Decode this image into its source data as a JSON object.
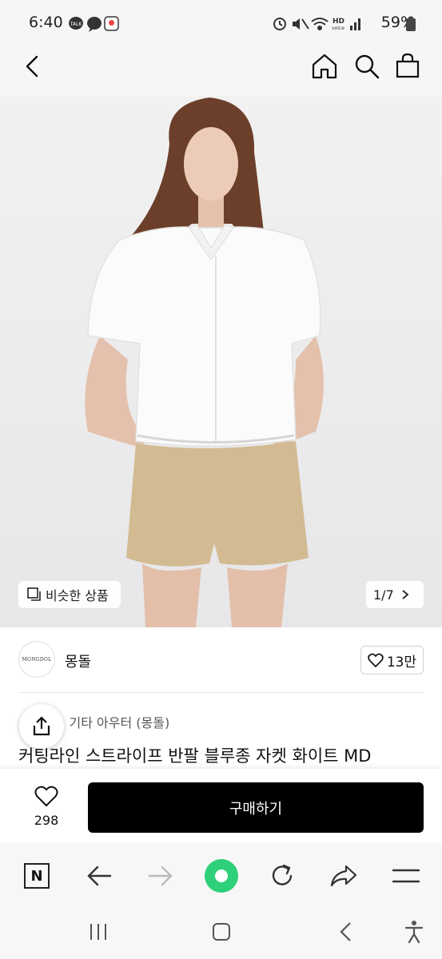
{
  "status_bar": {
    "time": "6:40",
    "battery": "59%",
    "icons": [
      "talk-icon",
      "chat-bubble-icon",
      "location-app-icon",
      "alarm-icon",
      "mute-icon",
      "wifi-icon",
      "hd-voice-icon",
      "signal-icon",
      "battery-icon"
    ]
  },
  "header": {
    "icons": [
      "back-arrow-icon",
      "home-icon",
      "search-icon",
      "shopping-bag-icon"
    ]
  },
  "hero": {
    "similar_label": "비슷한 상품",
    "counter": "1/7"
  },
  "shop": {
    "logo_text": "MONGDOL",
    "name": "몽돌",
    "like_count": "13만"
  },
  "product": {
    "breadcrumb": "> 기타 아우터 (몽돌)",
    "title": "커팅라인 스트라이프 반팔 블루종 자켓 화이트 MD"
  },
  "purchase": {
    "wish_count": "298",
    "buy_label": "구매하기"
  },
  "browser": {
    "icons": [
      "naver-n-icon",
      "back-icon",
      "forward-icon",
      "green-dot-icon",
      "reload-icon",
      "share-icon",
      "menu-icon"
    ],
    "naver_letter": "N"
  },
  "system_nav": {
    "icons": [
      "recent-apps-icon",
      "home-button-icon",
      "back-button-icon",
      "accessibility-icon"
    ]
  },
  "colors": {
    "accent_green": "#2fd07a",
    "buy_button": "#000000",
    "hero_bg": "#eeeeef"
  }
}
